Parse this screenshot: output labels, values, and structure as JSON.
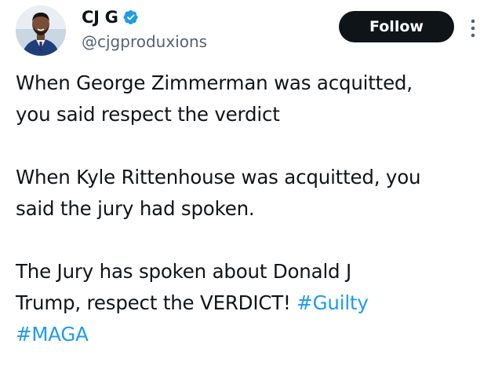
{
  "author": {
    "display_name": "CJ G",
    "handle": "@cjgproduxions",
    "verified": true,
    "avatar_icon": "profile-photo"
  },
  "actions": {
    "follow_label": "Follow",
    "more_icon": "more-vertical-icon"
  },
  "tweet": {
    "paragraph_1": "When George Zimmerman was acquitted,\nyou said respect the verdict",
    "paragraph_2": "When Kyle Rittenhouse was acquitted, you\nsaid the jury had spoken.",
    "paragraph_3_text": "The Jury has spoken about Donald J\nTrump, respect the VERDICT! ",
    "hashtag_1": "#Guilty",
    "hashtag_2": "#MAGA"
  },
  "colors": {
    "text": "#0f1419",
    "secondary": "#536471",
    "link": "#1d9bf0",
    "button_bg": "#0f1419",
    "button_text": "#ffffff",
    "verified": "#1d9bf0"
  }
}
